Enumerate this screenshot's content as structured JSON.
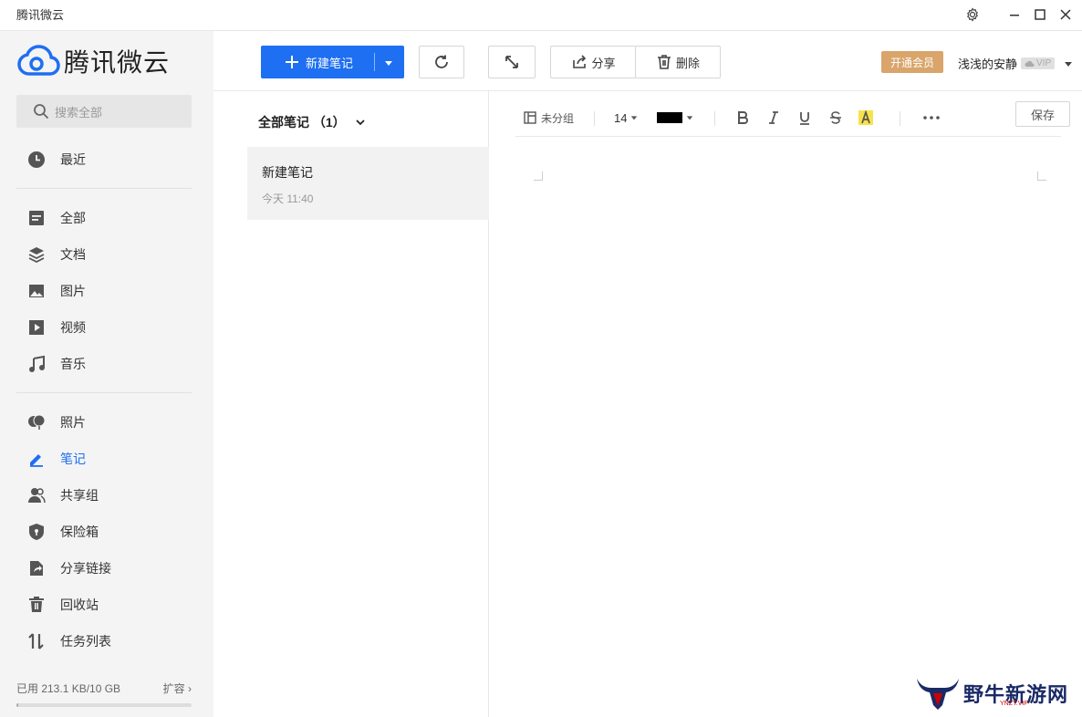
{
  "window": {
    "title": "腾讯微云"
  },
  "logo": {
    "text": "腾讯微云"
  },
  "search": {
    "placeholder": "搜索全部"
  },
  "sidebar": {
    "items": [
      {
        "label": "最近"
      },
      {
        "label": "全部"
      },
      {
        "label": "文档"
      },
      {
        "label": "图片"
      },
      {
        "label": "视频"
      },
      {
        "label": "音乐"
      },
      {
        "label": "照片"
      },
      {
        "label": "笔记"
      },
      {
        "label": "共享组"
      },
      {
        "label": "保险箱"
      },
      {
        "label": "分享链接"
      },
      {
        "label": "回收站"
      },
      {
        "label": "任务列表"
      }
    ],
    "active": "笔记"
  },
  "storage": {
    "used": "已用 213.1 KB/10 GB",
    "expand": "扩容",
    "usage_fraction": 0.0
  },
  "toolbar": {
    "new_note": "新建笔记",
    "share": "分享",
    "delete": "删除",
    "vip": "开通会员",
    "username": "浅浅的安静",
    "vip_tag": "VIP"
  },
  "notelist": {
    "header": "全部笔记 （1）",
    "notes": [
      {
        "title": "新建笔记",
        "time": "今天 11:40"
      }
    ]
  },
  "editor": {
    "group": "未分组",
    "font_size": "14",
    "save": "保存",
    "text_color": "#000000",
    "highlight_color": "#f7e24b"
  },
  "watermark": {
    "text": "野牛新游网",
    "sub": "YNZY.VIP"
  },
  "colors": {
    "accent": "#1e6ff1",
    "vip": "#d9a56b"
  }
}
